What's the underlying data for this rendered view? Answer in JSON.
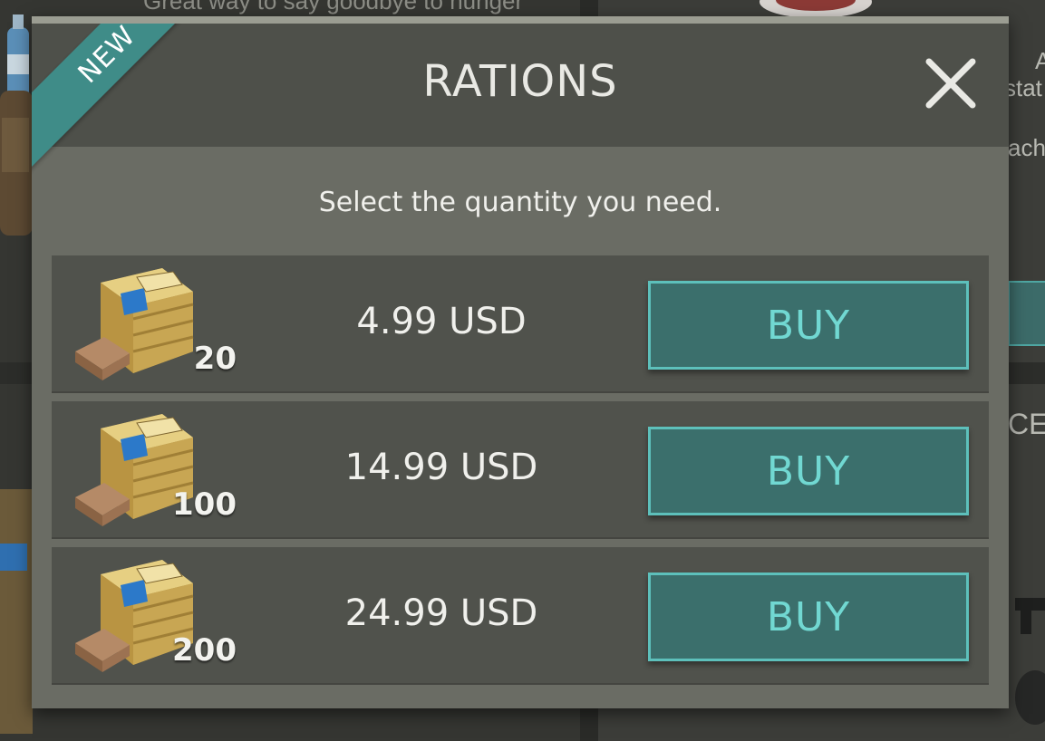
{
  "background": {
    "teaser_text": "Great way to say goodbye to hunger",
    "right_fragments": [
      "A",
      "stat",
      "ach",
      "CE"
    ]
  },
  "modal": {
    "title": "RATIONS",
    "ribbon": "NEW",
    "subtitle": "Select the quantity you need.",
    "close_icon": "close-x-icon",
    "accent_color": "#3f8c88",
    "button_color": "#3b6f6c",
    "button_text_color": "#71d8d2"
  },
  "offers": [
    {
      "icon": "ration-crate-icon",
      "quantity": "20",
      "price": "4.99 USD",
      "button_label": "BUY"
    },
    {
      "icon": "ration-crate-icon",
      "quantity": "100",
      "price": "14.99 USD",
      "button_label": "BUY"
    },
    {
      "icon": "ration-crate-icon",
      "quantity": "200",
      "price": "24.99 USD",
      "button_label": "BUY"
    }
  ]
}
